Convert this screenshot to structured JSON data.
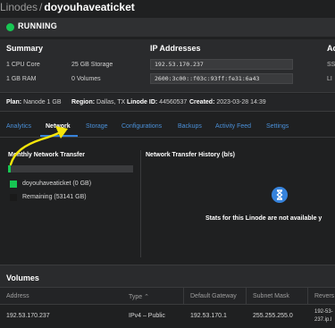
{
  "breadcrumb": {
    "parent": "Linodes",
    "separator": "/",
    "current": "doyouhaveaticket"
  },
  "status": {
    "label": "RUNNING",
    "color": "#17c653"
  },
  "summary": {
    "title": "Summary",
    "cpu": "1 CPU Core",
    "storage": "25 GB Storage",
    "ram": "1 GB RAM",
    "volumes": "0 Volumes"
  },
  "ip": {
    "title": "IP Addresses",
    "ipv4": "192.53.170.237",
    "ipv6": "2600:3c00::f03c:93ff:fe31:6a43"
  },
  "right_column": {
    "title_partial": "Ac",
    "label1": "SS",
    "label2": "LI"
  },
  "details": {
    "plan_label": "Plan:",
    "plan_value": "Nanode 1 GB",
    "region_label": "Region:",
    "region_value": "Dallas, TX",
    "id_label": "Linode ID:",
    "id_value": "44560537",
    "created_label": "Created:",
    "created_value": "2023-03-28 14:39"
  },
  "tabs": [
    {
      "label": "Analytics"
    },
    {
      "label": "Network"
    },
    {
      "label": "Storage"
    },
    {
      "label": "Configurations"
    },
    {
      "label": "Backups"
    },
    {
      "label": "Activity Feed"
    },
    {
      "label": "Settings"
    }
  ],
  "network": {
    "transfer_title": "Monthly Network Transfer",
    "history_title": "Network Transfer History (b/s)",
    "used_fraction": 0.02,
    "legend_used": "doyouhaveaticket (0 GB)",
    "legend_remaining": "Remaining (53141 GB)",
    "empty_message": "Stats for this Linode are not available y"
  },
  "colors": {
    "accent": "#3683dc",
    "green": "#17c653",
    "link": "#4a90d9",
    "annotation": "#f5e50a"
  },
  "volumes": {
    "title": "Volumes",
    "columns": [
      "Address",
      "Type ⌃",
      "Default Gateway",
      "Subnet Mask",
      "Revers"
    ],
    "row": {
      "address": "192.53.170.237",
      "type": "IPv4 – Public",
      "gateway": "192.53.170.1",
      "mask": "255.255.255.0",
      "reverse1": "192-53-",
      "reverse2": "237.ip.l"
    }
  }
}
